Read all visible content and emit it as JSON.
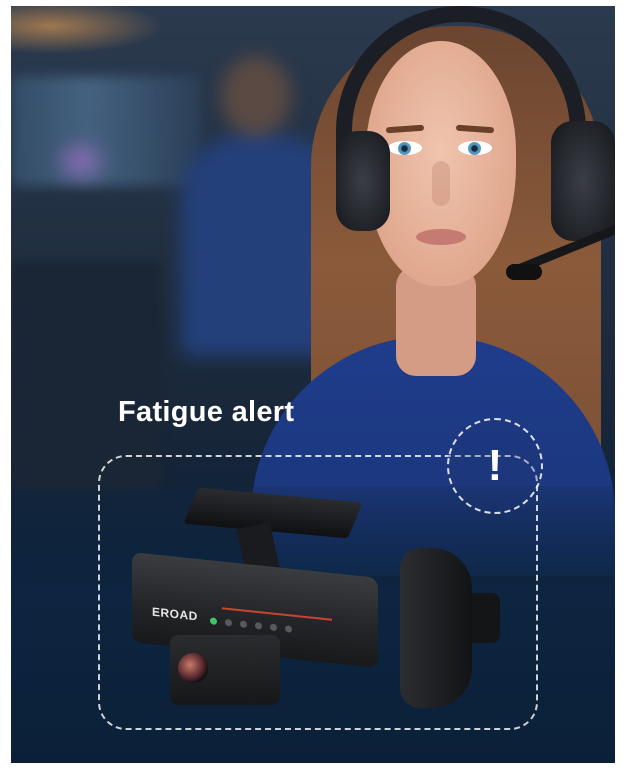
{
  "overlay": {
    "title": "Fatigue alert",
    "alert_symbol": "!"
  },
  "device": {
    "logo": "EROAD"
  },
  "colors": {
    "overlay_text": "#ffffff",
    "shirt": "#1f3d8c",
    "background_dark": "#0b1a2e",
    "status_led": "#3fc46a"
  },
  "icons": {
    "alert": "exclamation-icon"
  }
}
